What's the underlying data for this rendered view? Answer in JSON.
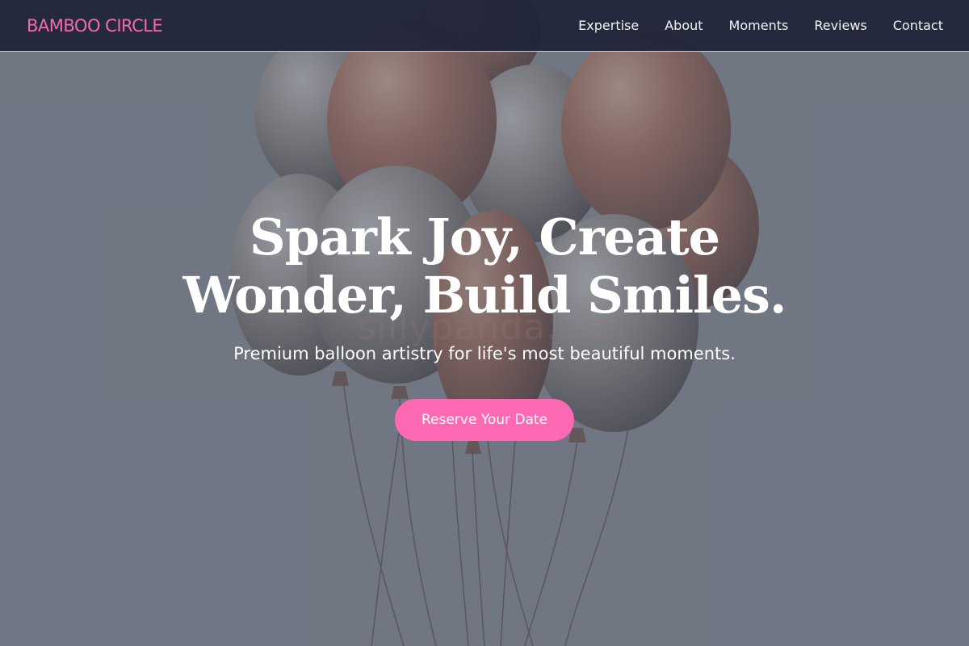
{
  "nav": {
    "brand": "BAMBOO CIRCLE",
    "links": [
      "Expertise",
      "About",
      "Moments",
      "Reviews",
      "Contact"
    ]
  },
  "hero": {
    "headline_line1": "Spark Joy, Create",
    "headline_line2": "Wonder, Build Smiles.",
    "subheadline": "Premium balloon artistry for life's most beautiful moments.",
    "cta_label": "Reserve Your Date",
    "watermark": "sillypanda.biz"
  },
  "colors": {
    "brand": "#f26cae",
    "cta": "#ff69b4",
    "nav_bg": "#1e2438",
    "overlay": "#5c6273"
  }
}
